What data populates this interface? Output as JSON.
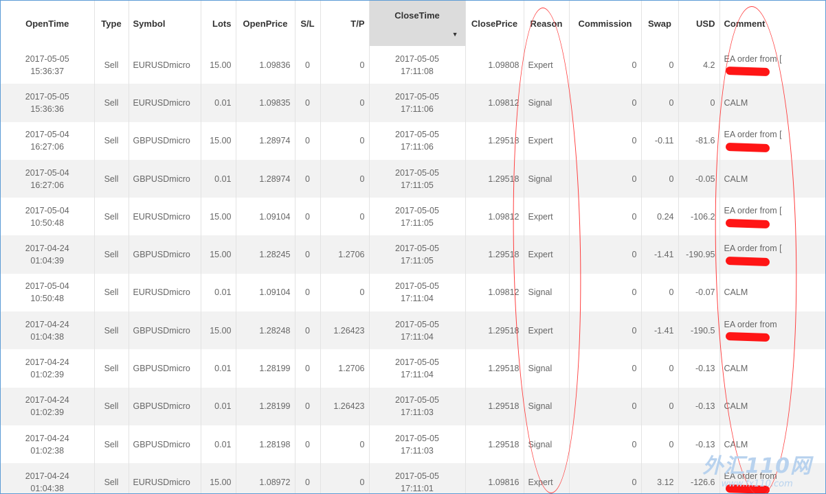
{
  "columns": [
    {
      "key": "open_time",
      "label": "OpenTime"
    },
    {
      "key": "type",
      "label": "Type"
    },
    {
      "key": "symbol",
      "label": "Symbol"
    },
    {
      "key": "lots",
      "label": "Lots"
    },
    {
      "key": "open_price",
      "label": "OpenPrice"
    },
    {
      "key": "sl",
      "label": "S/L"
    },
    {
      "key": "tp",
      "label": "T/P"
    },
    {
      "key": "close_time",
      "label": "CloseTime"
    },
    {
      "key": "close_price",
      "label": "ClosePrice"
    },
    {
      "key": "reason",
      "label": "Reason"
    },
    {
      "key": "commission",
      "label": "Commission"
    },
    {
      "key": "swap",
      "label": "Swap"
    },
    {
      "key": "usd",
      "label": "USD"
    },
    {
      "key": "comment",
      "label": "Comment"
    }
  ],
  "sort": {
    "column": "CloseTime",
    "arrow": "▼"
  },
  "rows": [
    {
      "open_date": "2017-05-05",
      "open_clock": "15:36:37",
      "type": "Sell",
      "symbol": "EURUSDmicro",
      "lots": "15.00",
      "open_price": "1.09836",
      "sl": "0",
      "tp": "0",
      "close_date": "2017-05-05",
      "close_clock": "17:11:08",
      "close_price": "1.09808",
      "reason": "Expert",
      "commission": "0",
      "swap": "0",
      "usd": "4.2",
      "comment": "EA order from [",
      "redacted": true
    },
    {
      "open_date": "2017-05-05",
      "open_clock": "15:36:36",
      "type": "Sell",
      "symbol": "EURUSDmicro",
      "lots": "0.01",
      "open_price": "1.09835",
      "sl": "0",
      "tp": "0",
      "close_date": "2017-05-05",
      "close_clock": "17:11:06",
      "close_price": "1.09812",
      "reason": "Signal",
      "commission": "0",
      "swap": "0",
      "usd": "0",
      "comment": "CALM",
      "redacted": false
    },
    {
      "open_date": "2017-05-04",
      "open_clock": "16:27:06",
      "type": "Sell",
      "symbol": "GBPUSDmicro",
      "lots": "15.00",
      "open_price": "1.28974",
      "sl": "0",
      "tp": "0",
      "close_date": "2017-05-05",
      "close_clock": "17:11:06",
      "close_price": "1.29518",
      "reason": "Expert",
      "commission": "0",
      "swap": "-0.11",
      "usd": "-81.6",
      "comment": "EA order from [",
      "redacted": true
    },
    {
      "open_date": "2017-05-04",
      "open_clock": "16:27:06",
      "type": "Sell",
      "symbol": "GBPUSDmicro",
      "lots": "0.01",
      "open_price": "1.28974",
      "sl": "0",
      "tp": "0",
      "close_date": "2017-05-05",
      "close_clock": "17:11:05",
      "close_price": "1.29518",
      "reason": "Signal",
      "commission": "0",
      "swap": "0",
      "usd": "-0.05",
      "comment": "CALM",
      "redacted": false
    },
    {
      "open_date": "2017-05-04",
      "open_clock": "10:50:48",
      "type": "Sell",
      "symbol": "EURUSDmicro",
      "lots": "15.00",
      "open_price": "1.09104",
      "sl": "0",
      "tp": "0",
      "close_date": "2017-05-05",
      "close_clock": "17:11:05",
      "close_price": "1.09812",
      "reason": "Expert",
      "commission": "0",
      "swap": "0.24",
      "usd": "-106.2",
      "comment": "EA order from [",
      "redacted": true
    },
    {
      "open_date": "2017-04-24",
      "open_clock": "01:04:39",
      "type": "Sell",
      "symbol": "GBPUSDmicro",
      "lots": "15.00",
      "open_price": "1.28245",
      "sl": "0",
      "tp": "1.2706",
      "close_date": "2017-05-05",
      "close_clock": "17:11:05",
      "close_price": "1.29518",
      "reason": "Expert",
      "commission": "0",
      "swap": "-1.41",
      "usd": "-190.95",
      "comment": "EA order from [",
      "redacted": true
    },
    {
      "open_date": "2017-05-04",
      "open_clock": "10:50:48",
      "type": "Sell",
      "symbol": "EURUSDmicro",
      "lots": "0.01",
      "open_price": "1.09104",
      "sl": "0",
      "tp": "0",
      "close_date": "2017-05-05",
      "close_clock": "17:11:04",
      "close_price": "1.09812",
      "reason": "Signal",
      "commission": "0",
      "swap": "0",
      "usd": "-0.07",
      "comment": "CALM",
      "redacted": false
    },
    {
      "open_date": "2017-04-24",
      "open_clock": "01:04:38",
      "type": "Sell",
      "symbol": "GBPUSDmicro",
      "lots": "15.00",
      "open_price": "1.28248",
      "sl": "0",
      "tp": "1.26423",
      "close_date": "2017-05-05",
      "close_clock": "17:11:04",
      "close_price": "1.29518",
      "reason": "Expert",
      "commission": "0",
      "swap": "-1.41",
      "usd": "-190.5",
      "comment": "EA order from",
      "redacted": true
    },
    {
      "open_date": "2017-04-24",
      "open_clock": "01:02:39",
      "type": "Sell",
      "symbol": "GBPUSDmicro",
      "lots": "0.01",
      "open_price": "1.28199",
      "sl": "0",
      "tp": "1.2706",
      "close_date": "2017-05-05",
      "close_clock": "17:11:04",
      "close_price": "1.29518",
      "reason": "Signal",
      "commission": "0",
      "swap": "0",
      "usd": "-0.13",
      "comment": "CALM",
      "redacted": false
    },
    {
      "open_date": "2017-04-24",
      "open_clock": "01:02:39",
      "type": "Sell",
      "symbol": "GBPUSDmicro",
      "lots": "0.01",
      "open_price": "1.28199",
      "sl": "0",
      "tp": "1.26423",
      "close_date": "2017-05-05",
      "close_clock": "17:11:03",
      "close_price": "1.29518",
      "reason": "Signal",
      "commission": "0",
      "swap": "0",
      "usd": "-0.13",
      "comment": "CALM",
      "redacted": false
    },
    {
      "open_date": "2017-04-24",
      "open_clock": "01:02:38",
      "type": "Sell",
      "symbol": "GBPUSDmicro",
      "lots": "0.01",
      "open_price": "1.28198",
      "sl": "0",
      "tp": "0",
      "close_date": "2017-05-05",
      "close_clock": "17:11:03",
      "close_price": "1.29518",
      "reason": "Signal",
      "commission": "0",
      "swap": "0",
      "usd": "-0.13",
      "comment": "CALM",
      "redacted": false
    },
    {
      "open_date": "2017-04-24",
      "open_clock": "01:04:38",
      "type": "Sell",
      "symbol": "EURUSDmicro",
      "lots": "15.00",
      "open_price": "1.08972",
      "sl": "0",
      "tp": "0",
      "close_date": "2017-05-05",
      "close_clock": "17:11:01",
      "close_price": "1.09816",
      "reason": "Expert",
      "commission": "0",
      "swap": "3.12",
      "usd": "-126.6",
      "comment": "EA order from",
      "redacted": true
    }
  ],
  "watermark": {
    "main": "外汇110网",
    "url": "www.fx110.com"
  },
  "colors": {
    "annotation": "#ff3b3b",
    "redaction": "#ff1515",
    "sorted_header": "#dcdcdc",
    "row_alt": "#f2f2f2",
    "frame": "#5b9bd5"
  }
}
